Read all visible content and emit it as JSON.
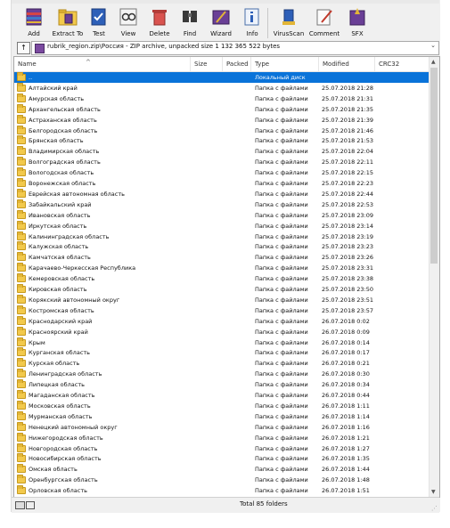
{
  "toolbar": {
    "buttons": [
      {
        "label": "Add",
        "icon": "add-icon"
      },
      {
        "label": "Extract To",
        "icon": "extract-icon"
      },
      {
        "label": "Test",
        "icon": "test-icon"
      },
      {
        "label": "View",
        "icon": "view-icon"
      },
      {
        "label": "Delete",
        "icon": "delete-icon"
      },
      {
        "label": "Find",
        "icon": "find-icon"
      },
      {
        "label": "Wizard",
        "icon": "wizard-icon"
      },
      {
        "label": "Info",
        "icon": "info-icon"
      },
      {
        "label": "VirusScan",
        "icon": "virusscan-icon"
      },
      {
        "label": "Comment",
        "icon": "comment-icon"
      },
      {
        "label": "SFX",
        "icon": "sfx-icon"
      }
    ]
  },
  "address": {
    "up_label": "↑",
    "path": "rubrik_region.zip\\Россия - ZIP archive, unpacked size 1 132 365 522 bytes",
    "dropdown": "⌄"
  },
  "columns": {
    "name": "Name",
    "size": "Size",
    "packed": "Packed",
    "type": "Type",
    "modified": "Modified",
    "crc": "CRC32"
  },
  "sort_indicator": "^",
  "parent_row": {
    "name": "..",
    "type": "Локальный диск"
  },
  "rows": [
    {
      "name": "Алтайский край",
      "type": "Папка с файлами",
      "modified": "25.07.2018 21:28"
    },
    {
      "name": "Амурская область",
      "type": "Папка с файлами",
      "modified": "25.07.2018 21:31"
    },
    {
      "name": "Архангельская область",
      "type": "Папка с файлами",
      "modified": "25.07.2018 21:35"
    },
    {
      "name": "Астраханская область",
      "type": "Папка с файлами",
      "modified": "25.07.2018 21:39"
    },
    {
      "name": "Белгородская область",
      "type": "Папка с файлами",
      "modified": "25.07.2018 21:46"
    },
    {
      "name": "Брянская область",
      "type": "Папка с файлами",
      "modified": "25.07.2018 21:53"
    },
    {
      "name": "Владимирская область",
      "type": "Папка с файлами",
      "modified": "25.07.2018 22:04"
    },
    {
      "name": "Волгоградская область",
      "type": "Папка с файлами",
      "modified": "25.07.2018 22:11"
    },
    {
      "name": "Вологодская область",
      "type": "Папка с файлами",
      "modified": "25.07.2018 22:15"
    },
    {
      "name": "Воронежская область",
      "type": "Папка с файлами",
      "modified": "25.07.2018 22:23"
    },
    {
      "name": "Еврейская автономная область",
      "type": "Папка с файлами",
      "modified": "25.07.2018 22:44"
    },
    {
      "name": "Забайкальский край",
      "type": "Папка с файлами",
      "modified": "25.07.2018 22:53"
    },
    {
      "name": "Ивановская область",
      "type": "Папка с файлами",
      "modified": "25.07.2018 23:09"
    },
    {
      "name": "Иркутская область",
      "type": "Папка с файлами",
      "modified": "25.07.2018 23:14"
    },
    {
      "name": "Калининградская область",
      "type": "Папка с файлами",
      "modified": "25.07.2018 23:19"
    },
    {
      "name": "Калужская область",
      "type": "Папка с файлами",
      "modified": "25.07.2018 23:23"
    },
    {
      "name": "Камчатская область",
      "type": "Папка с файлами",
      "modified": "25.07.2018 23:26"
    },
    {
      "name": "Карачаево-Черкесская Республика",
      "type": "Папка с файлами",
      "modified": "25.07.2018 23:31"
    },
    {
      "name": "Кемеровская область",
      "type": "Папка с файлами",
      "modified": "25.07.2018 23:38"
    },
    {
      "name": "Кировская область",
      "type": "Папка с файлами",
      "modified": "25.07.2018 23:50"
    },
    {
      "name": "Корякский автономный округ",
      "type": "Папка с файлами",
      "modified": "25.07.2018 23:51"
    },
    {
      "name": "Костромская область",
      "type": "Папка с файлами",
      "modified": "25.07.2018 23:57"
    },
    {
      "name": "Краснодарский край",
      "type": "Папка с файлами",
      "modified": "26.07.2018 0:02"
    },
    {
      "name": "Красноярский край",
      "type": "Папка с файлами",
      "modified": "26.07.2018 0:09"
    },
    {
      "name": "Крым",
      "type": "Папка с файлами",
      "modified": "26.07.2018 0:14"
    },
    {
      "name": "Курганская область",
      "type": "Папка с файлами",
      "modified": "26.07.2018 0:17"
    },
    {
      "name": "Курская область",
      "type": "Папка с файлами",
      "modified": "26.07.2018 0:21"
    },
    {
      "name": "Ленинградская область",
      "type": "Папка с файлами",
      "modified": "26.07.2018 0:30"
    },
    {
      "name": "Липецкая область",
      "type": "Папка с файлами",
      "modified": "26.07.2018 0:34"
    },
    {
      "name": "Магаданская область",
      "type": "Папка с файлами",
      "modified": "26.07.2018 0:44"
    },
    {
      "name": "Московская область",
      "type": "Папка с файлами",
      "modified": "26.07.2018 1:11"
    },
    {
      "name": "Мурманская область",
      "type": "Папка с файлами",
      "modified": "26.07.2018 1:14"
    },
    {
      "name": "Ненецкий автономный округ",
      "type": "Папка с файлами",
      "modified": "26.07.2018 1:16"
    },
    {
      "name": "Нижегородская область",
      "type": "Папка с файлами",
      "modified": "26.07.2018 1:21"
    },
    {
      "name": "Новгородская область",
      "type": "Папка с файлами",
      "modified": "26.07.2018 1:27"
    },
    {
      "name": "Новосибирская область",
      "type": "Папка с файлами",
      "modified": "26.07.2018 1:35"
    },
    {
      "name": "Омская область",
      "type": "Папка с файлами",
      "modified": "26.07.2018 1:44"
    },
    {
      "name": "Оренбургская область",
      "type": "Папка с файлами",
      "modified": "26.07.2018 1:48"
    },
    {
      "name": "Орловская область",
      "type": "Папка с файлами",
      "modified": "26.07.2018 1:51"
    }
  ],
  "status": {
    "text": "Total 85 folders",
    "grip": "⋰"
  },
  "colors": {
    "selection": "#0a73d9",
    "folder": "#f2c94c"
  }
}
